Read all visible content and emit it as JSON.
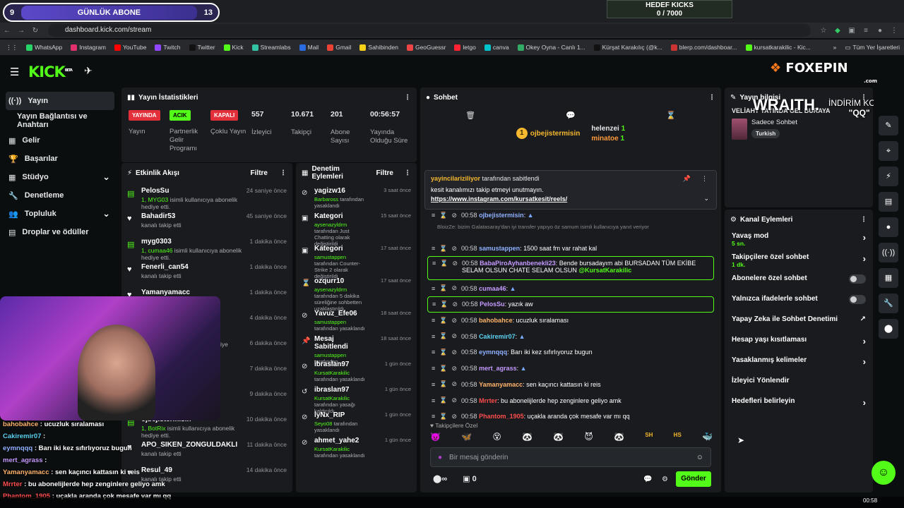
{
  "overlay": {
    "sub_goal_left": "9",
    "sub_goal_label": "GÜNLÜK ABONE",
    "sub_goal_right": "13",
    "kicks_title": "HEDEF KICKS",
    "kicks_value": "0 / 7000",
    "sponsor_logo": "FOXEPIN",
    "sponsor_sub": ".com",
    "sponsor_game": "WRAITH.",
    "sponsor_code_label": "İNDİRİM KODU:",
    "sponsor_code": "\"QQ\""
  },
  "browser": {
    "url": "dashboard.kick.com/stream",
    "bookmarks": [
      "WhatsApp",
      "Instagram",
      "YouTube",
      "Twitch",
      "Twitter",
      "Kick",
      "Streamlabs",
      "Mail",
      "Gmail",
      "Sahibinden",
      "GeoGuessr",
      "letgo",
      "canva",
      "Okey Oyna - Canlı 1...",
      "Kürşat Karakılıç (@k...",
      "blerp.com/dashboar...",
      "kursatkarakilic - Kic..."
    ],
    "all_bookmarks": "Tüm Yer İşaretleri",
    "bookmark_colors": [
      "#25d366",
      "#e1306c",
      "#ff0000",
      "#9146ff",
      "#111111",
      "#53fc18",
      "#31c3a2",
      "#2b6be0",
      "#ea4335",
      "#f7d117",
      "#e44",
      "#f23",
      "#00c4cc",
      "#3a6",
      "#111",
      "#c33",
      "#53fc18"
    ]
  },
  "header": {
    "logo": "KICK",
    "logo_beta": "BETA"
  },
  "sidebar": {
    "items": [
      {
        "label": "Yayın",
        "icon": "((·))"
      },
      {
        "label": "Yayın Bağlantısı ve Anahtarı",
        "icon": ""
      },
      {
        "label": "Gelir",
        "icon": "▦"
      },
      {
        "label": "Başarılar",
        "icon": "🏆"
      },
      {
        "label": "Stüdyo",
        "icon": "▦"
      },
      {
        "label": "Denetleme",
        "icon": "🔧"
      },
      {
        "label": "Topluluk",
        "icon": "👥"
      },
      {
        "label": "Droplar ve ödüller",
        "icon": "▤"
      }
    ]
  },
  "stats": {
    "title": "Yayın İstatistikleri",
    "items": [
      {
        "badge": "YAYINDA",
        "label": "Yayın",
        "color": "#e22f3a"
      },
      {
        "badge": "ACIK",
        "label": "Partnerlik Gelir Programı",
        "color": "#53fc18"
      },
      {
        "badge": "KAPALI",
        "label": "Çoklu Yayın",
        "color": "#e22f3a"
      },
      {
        "value": "557",
        "label": "İzleyici"
      },
      {
        "value": "10.671",
        "label": "Takipçi"
      },
      {
        "value": "201",
        "label": "Abone Sayısı"
      },
      {
        "value": "00:56:57",
        "label": "Yayında Olduğu Süre"
      }
    ]
  },
  "activity": {
    "title": "Etkinlik Akışı",
    "filter": "Filtre",
    "events": [
      {
        "name": "PelosSu",
        "desc_user": "1, MYG03",
        "desc": " isimli kullanıcıya abonelik hediye etti.",
        "time": "24 saniye önce",
        "type": "gift"
      },
      {
        "name": "Bahadir53",
        "desc_user": "",
        "desc": "kanalı takip etti",
        "time": "45 saniye önce",
        "type": "follow"
      },
      {
        "name": "myg0303",
        "desc_user": "1, cumaa46",
        "desc": " isimli kullanıcıya abonelik hediye etti.",
        "time": "1 dakika önce",
        "type": "gift"
      },
      {
        "name": "Fenerli_can54",
        "desc_user": "",
        "desc": "kanalı takip etti",
        "time": "1 dakika önce",
        "type": "follow"
      },
      {
        "name": "Yamanyamacc",
        "desc_user": "",
        "desc": "",
        "time": "1 dakika önce",
        "type": "follow"
      },
      {
        "name": "",
        "desc_user": "",
        "desc": "",
        "time": "4 dakika önce",
        "type": "gift"
      },
      {
        "name": "",
        "desc_user": "",
        "desc": "isimli kullanıcıya abonelik hediye",
        "time": "6 dakika önce",
        "type": "gift"
      },
      {
        "name": "",
        "desc_user": "",
        "desc": "",
        "time": "7 dakika önce",
        "type": "follow"
      },
      {
        "name": "",
        "desc_user": "",
        "desc": "",
        "time": "9 dakika önce",
        "type": "follow"
      },
      {
        "name": "ojbejistermisin",
        "desc_user": "1, BotRix",
        "desc": " isimli kullanıcıya abonelik hediye etti.",
        "time": "10 dakika önce",
        "type": "gift"
      },
      {
        "name": "APO_SIKEN_ZONGULDAKLI",
        "desc_user": "",
        "desc": "kanalı takip etti",
        "time": "11 dakika önce",
        "type": "follow"
      },
      {
        "name": "Resul_49",
        "desc_user": "",
        "desc": "kanalı takip etti",
        "time": "14 dakika önce",
        "type": "follow"
      }
    ]
  },
  "moderation": {
    "title": "Denetim Eylemleri",
    "filter": "Filtre",
    "items": [
      {
        "name": "yagizw16",
        "by": "Barbaross",
        "desc": " tarafından yasaklandı",
        "time": "3 saat önce",
        "icon": "⊘"
      },
      {
        "name": "Kategori",
        "by": "aysenazyldrm",
        "desc": " tarafından Just Chatting olarak değiştirildi",
        "by2": "Just Chatting",
        "time": "15 saat önce",
        "icon": "▣"
      },
      {
        "name": "Kategori",
        "by": "samustappen",
        "desc": " tarafından Counter-Strike 2 olarak değiştirildi",
        "time": "17 saat önce",
        "icon": "▣"
      },
      {
        "name": "ozqurr10",
        "by": "aysenazyldrm",
        "desc": " tarafından 5 dakika süreliğine sohbetten uzaklaştırıldı",
        "time": "17 saat önce",
        "icon": "⌛"
      },
      {
        "name": "Yavuz_Efe06",
        "by": "samustappen",
        "desc": " tarafından yasaklandı",
        "time": "18 saat önce",
        "icon": "⊘"
      },
      {
        "name": "Mesaj Sabitlendi",
        "by": "samustappen",
        "desc": " tarafından",
        "time": "18 saat önce",
        "icon": "📌"
      },
      {
        "name": "ibraslan97",
        "by": "KursatKarakilic",
        "desc": " tarafından yasaklandı",
        "time": "1 gün önce",
        "icon": "⊘"
      },
      {
        "name": "ibraslan97",
        "by": "KursatKarakilic",
        "desc": " tarafından yasağı kaldırıldı",
        "time": "1 gün önce",
        "icon": "↺"
      },
      {
        "name": "lyNx_RIP",
        "by": "Seyo08",
        "desc": " tarafından yasaklandı",
        "time": "1 gün önce",
        "icon": "⊘"
      },
      {
        "name": "ahmet_yahe2",
        "by": "KursatKarakilic",
        "desc": " tarafından yasaklandı",
        "time": "1 gün önce",
        "icon": "⊘"
      }
    ]
  },
  "chat": {
    "title": "Sohbet",
    "top_gifters": [
      {
        "rank": "1",
        "name": "ojbejistermisin"
      },
      {
        "name": "helenzei",
        "count": "1"
      },
      {
        "name": "minatoe",
        "count": "1"
      }
    ],
    "pinned": {
      "pinned_by": "yayincilariziliyor",
      "pinned_by_suffix": " tarafından sabitlendi",
      "text": "kesit kanalımızı takip etmeyi unutmayın.",
      "link": "https://www.instagram.com/kursatkesit/reels/"
    },
    "reply_preview": "BloizZe: bizim Galatasaray'dan iyi transfer yapıyo öz samum isimli kullanıcıya yanıt veriyor",
    "messages": [
      {
        "time": "00:58",
        "user": "ojbejistermisin",
        "text": "",
        "color": "#8fb1ff",
        "emote": true
      },
      {
        "time": "00:58",
        "user": "samustappen",
        "text": "1500 saat fm var rahat kal",
        "color": "#8fb1ff"
      },
      {
        "time": "00:58",
        "user": "BabaPiroAyhanbenekli23",
        "text": "Bende bursadayım abi BURSADAN TÜM EKİBE SELAM OLSUN CHATE SELAM OLSUN",
        "mention": "@KursatKarakilic",
        "color": "#c59bff",
        "highlight": true
      },
      {
        "time": "00:58",
        "user": "cumaa46",
        "text": "",
        "color": "#c59bff",
        "emote": true
      },
      {
        "time": "00:58",
        "user": "PelosSu",
        "text": "yazık aw",
        "color": "#c59bff",
        "highlight": true
      },
      {
        "time": "00:58",
        "user": "bahobahce",
        "text": "ucuzluk sıralaması",
        "color": "#ffb36b"
      },
      {
        "time": "00:58",
        "user": "Cakiremir07",
        "text": "",
        "color": "#5dd3f3",
        "emote": true
      },
      {
        "time": "00:58",
        "user": "eymnqqq",
        "text": "Barı iki kez sıfırlıyoruz bugun",
        "color": "#8fb1ff"
      },
      {
        "time": "00:58",
        "user": "mert_agrass",
        "text": "",
        "color": "#c59bff",
        "emote": true
      },
      {
        "time": "00:58",
        "user": "Yamanyamacc",
        "text": "sen kaçıncı kattasın ki reis",
        "color": "#ffb36b"
      },
      {
        "time": "00:58",
        "user": "Mrrter",
        "text": "bu abonelijlerde hep zenginlere geliyo amk",
        "color": "#ff4d4d"
      },
      {
        "time": "00:58",
        "user": "Phantom_1905",
        "text": "uçakla aranda çok mesafe var mı qq",
        "color": "#ff4d4d"
      }
    ],
    "followers_only": "Takipçilere Özel",
    "emotes": [
      "👿",
      "🦋",
      "😵",
      "🐼",
      "🐼",
      "😈",
      "🐼",
      "SH",
      "HS",
      "🐳"
    ],
    "input_placeholder": "Bir mesaj gönderin",
    "kicks_count": "0",
    "send": "Gönder",
    "infinity": "∞"
  },
  "stream_info": {
    "title": "Yayın bilgisi",
    "stream_title": "VELİAHT YAYINDA GEL BURAYA",
    "category": "Sadece Sohbet",
    "tag": "Turkish"
  },
  "channel_actions": {
    "title": "Kanal Eylemleri",
    "items": [
      {
        "label": "Yavaş mod",
        "sub": "5 sn.",
        "control": "chevron"
      },
      {
        "label": "Takipçilere özel sohbet",
        "sub": "1 dk.",
        "control": "chevron"
      },
      {
        "label": "Abonelere özel sohbet",
        "sub": "",
        "control": "toggle"
      },
      {
        "label": "Yalnızca ifadelerle sohbet",
        "sub": "",
        "control": "toggle"
      },
      {
        "label": "Yapay Zeka ile Sohbet Denetimi",
        "sub": "",
        "control": "external"
      },
      {
        "label": "Hesap yaşı kısıtlaması",
        "sub": "",
        "control": "chevron"
      },
      {
        "label": "Yasaklanmış kelimeler",
        "sub": "",
        "control": "chevron"
      },
      {
        "label": "İzleyici Yönlendir",
        "sub": "",
        "control": "none"
      },
      {
        "label": "Hedefleri belirleyin",
        "sub": "",
        "control": "chevron"
      }
    ]
  },
  "overlay_chat": [
    {
      "user": "bahobahce",
      "text": " : ucuzluk sıralaması",
      "color": "#ffb36b"
    },
    {
      "user": "Cakiremir07",
      "text": " : ",
      "color": "#5dd3f3"
    },
    {
      "user": "eymnqqq",
      "text": " : Barı iki kez sıfırlıyoruz bugun",
      "color": "#8fb1ff"
    },
    {
      "user": "mert_agrass",
      "text": " : ",
      "color": "#c59bff"
    },
    {
      "user": "Yamanyamacc",
      "text": " : sen kaçıncı kattasın ki reis",
      "color": "#ffb36b"
    },
    {
      "user": "Mrrter",
      "text": " : bu abonelijlerde hep zenginlere geliyo amk",
      "color": "#ff4d4d"
    },
    {
      "user": "Phantom_1905",
      "text": " : uçakla aranda çok mesafe var mı qq",
      "color": "#ff4d4d"
    }
  ],
  "taskbar": {
    "time": "00:58"
  }
}
